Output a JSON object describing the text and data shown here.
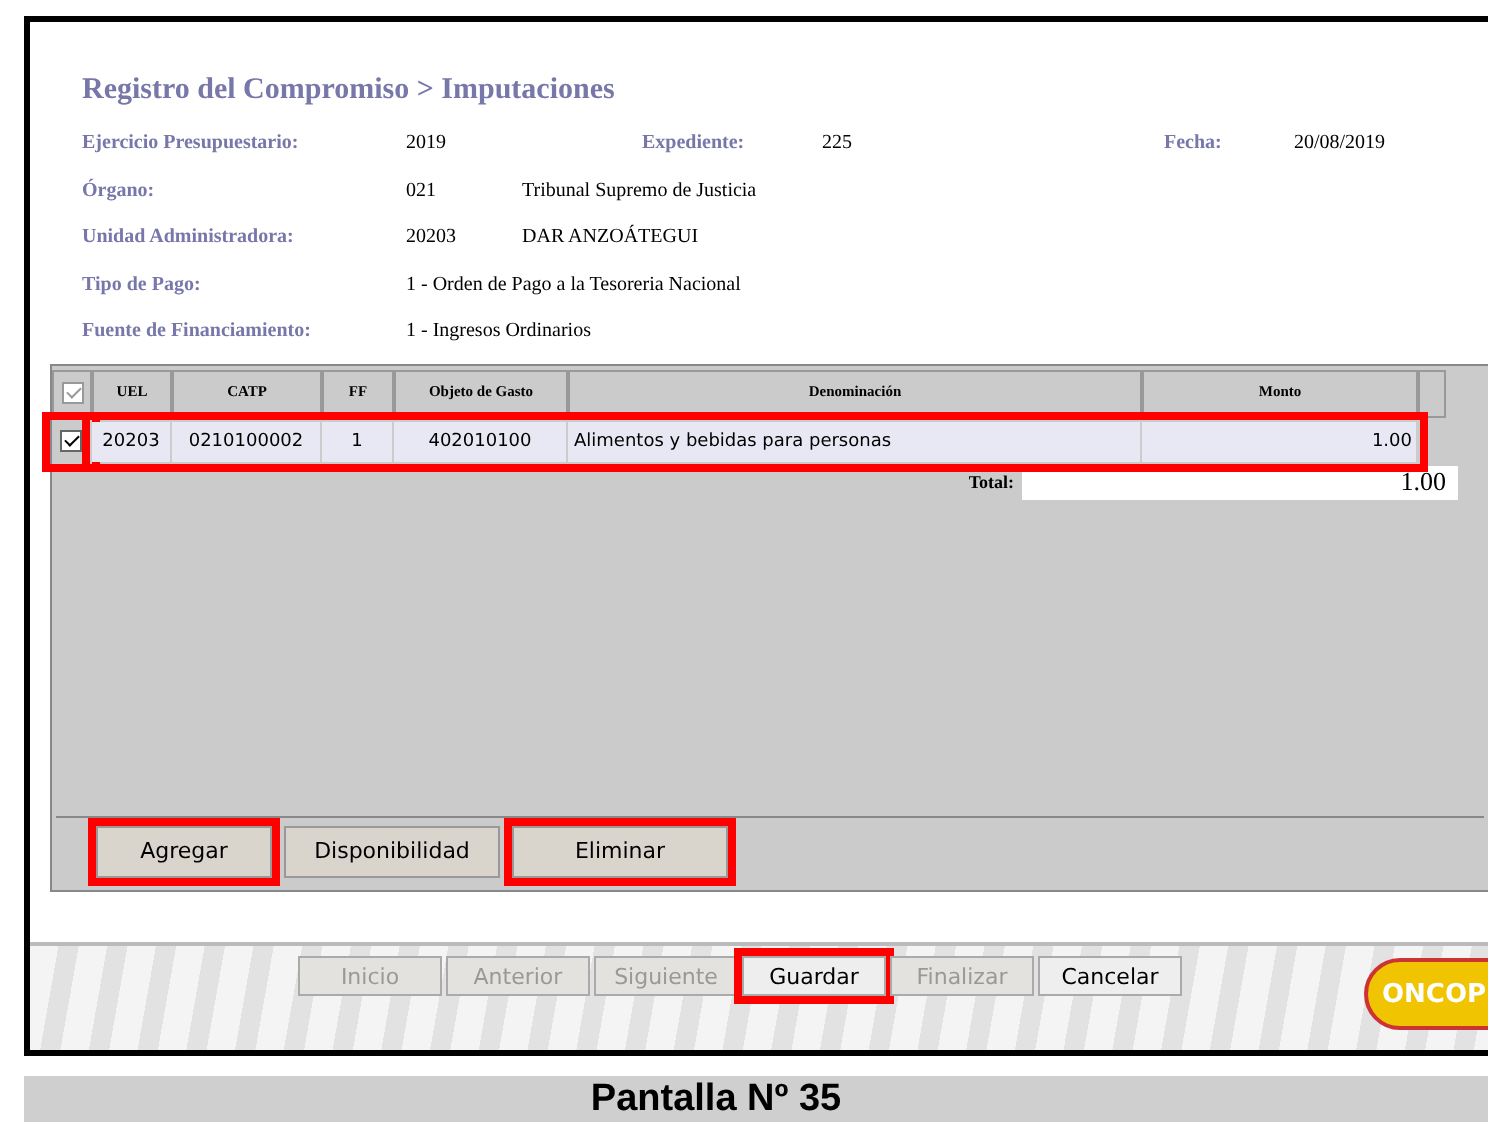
{
  "title": "Registro del Compromiso > Imputaciones",
  "fields": [
    {
      "label": "Ejercicio Presupuestario:",
      "value": "2019",
      "extra_label": "Expediente:",
      "extra_value": "225",
      "date_label": "Fecha:",
      "date_value": "20/08/2019"
    },
    {
      "label": "Órgano:",
      "value": "021",
      "description": "Tribunal Supremo de Justicia"
    },
    {
      "label": "Unidad Administradora:",
      "value": "20203",
      "description": "DAR ANZOÁTEGUI"
    },
    {
      "label": "Tipo de Pago:",
      "value": "1 - Orden de Pago a la Tesoreria Nacional"
    },
    {
      "label": "Fuente de Financiamiento:",
      "value": "1 - Ingresos Ordinarios"
    }
  ],
  "table": {
    "header_checked": true,
    "columns": [
      "UEL",
      "CATP",
      "FF",
      "Objeto de Gasto",
      "Denominación",
      "Monto"
    ],
    "rows": [
      {
        "checked": true,
        "checkbox_highlighted": true,
        "highlighted": true,
        "cells": [
          "20203",
          "0210100002",
          "1",
          "402010100",
          "Alimentos y bebidas para personas",
          "1.00"
        ]
      }
    ],
    "total_label": "Total:",
    "total_value": "1.00"
  },
  "actions": [
    {
      "label": "Agregar",
      "highlighted": true
    },
    {
      "label": "Disponibilidad",
      "highlighted": false
    },
    {
      "label": "Eliminar",
      "highlighted": true
    }
  ],
  "nav": [
    {
      "label": "Inicio",
      "disabled": true,
      "highlighted": false
    },
    {
      "label": "Anterior",
      "disabled": true,
      "highlighted": false
    },
    {
      "label": "Siguiente",
      "disabled": true,
      "highlighted": false
    },
    {
      "label": "Guardar",
      "disabled": false,
      "highlighted": true
    },
    {
      "label": "Finalizar",
      "disabled": true,
      "highlighted": false
    },
    {
      "label": "Cancelar",
      "disabled": false,
      "highlighted": false
    }
  ],
  "logo": "ONCOP",
  "caption": "Pantalla Nº 35"
}
